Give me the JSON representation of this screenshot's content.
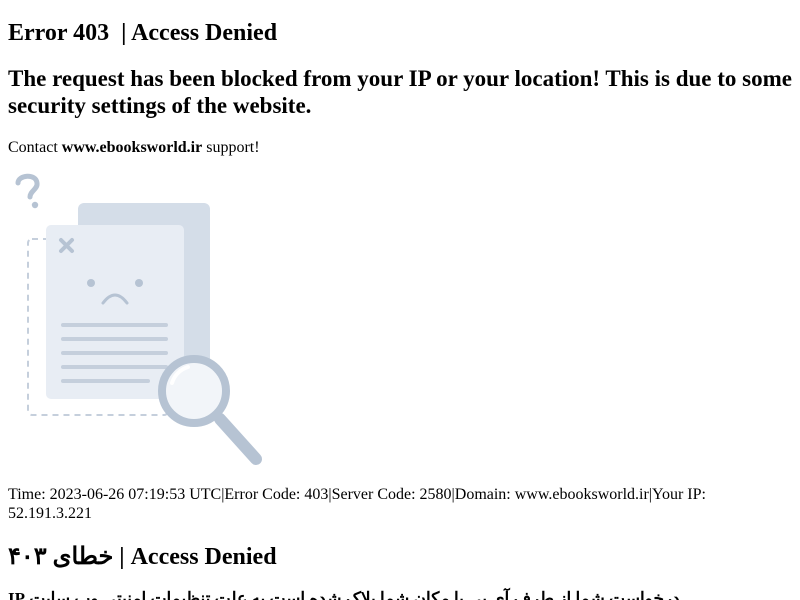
{
  "heading": {
    "error": "Error 403",
    "sep": "| Access Denied"
  },
  "headline": "The request has been blocked from your IP or your location! This is due to some security settings of the website.",
  "contact": {
    "prefix": "Contact ",
    "domain": "www.ebooksworld.ir",
    "suffix": " support!"
  },
  "illustration": {
    "icon": "document-error-magnifier-illustration",
    "colors": {
      "paper_back": "#d4dde8",
      "paper_front": "#e8edf4",
      "lines": "#c5cfdc",
      "accent": "#b6c3d3"
    }
  },
  "info": {
    "line": "Time: 2023-06-26 07:19:53 UTC|Error Code: 403|Server Code: 2580|Domain: www.ebooksworld.ir|Your IP: 52.191.3.221"
  },
  "fa_heading": {
    "error": "خطای ۴۰۳",
    "sep": "| Access Denied"
  },
  "fa_text": "درخواست شما از طرف آی پی یا مکان شما بلاک شده است به علت تنظیمات امنیتی وب سایت IP"
}
